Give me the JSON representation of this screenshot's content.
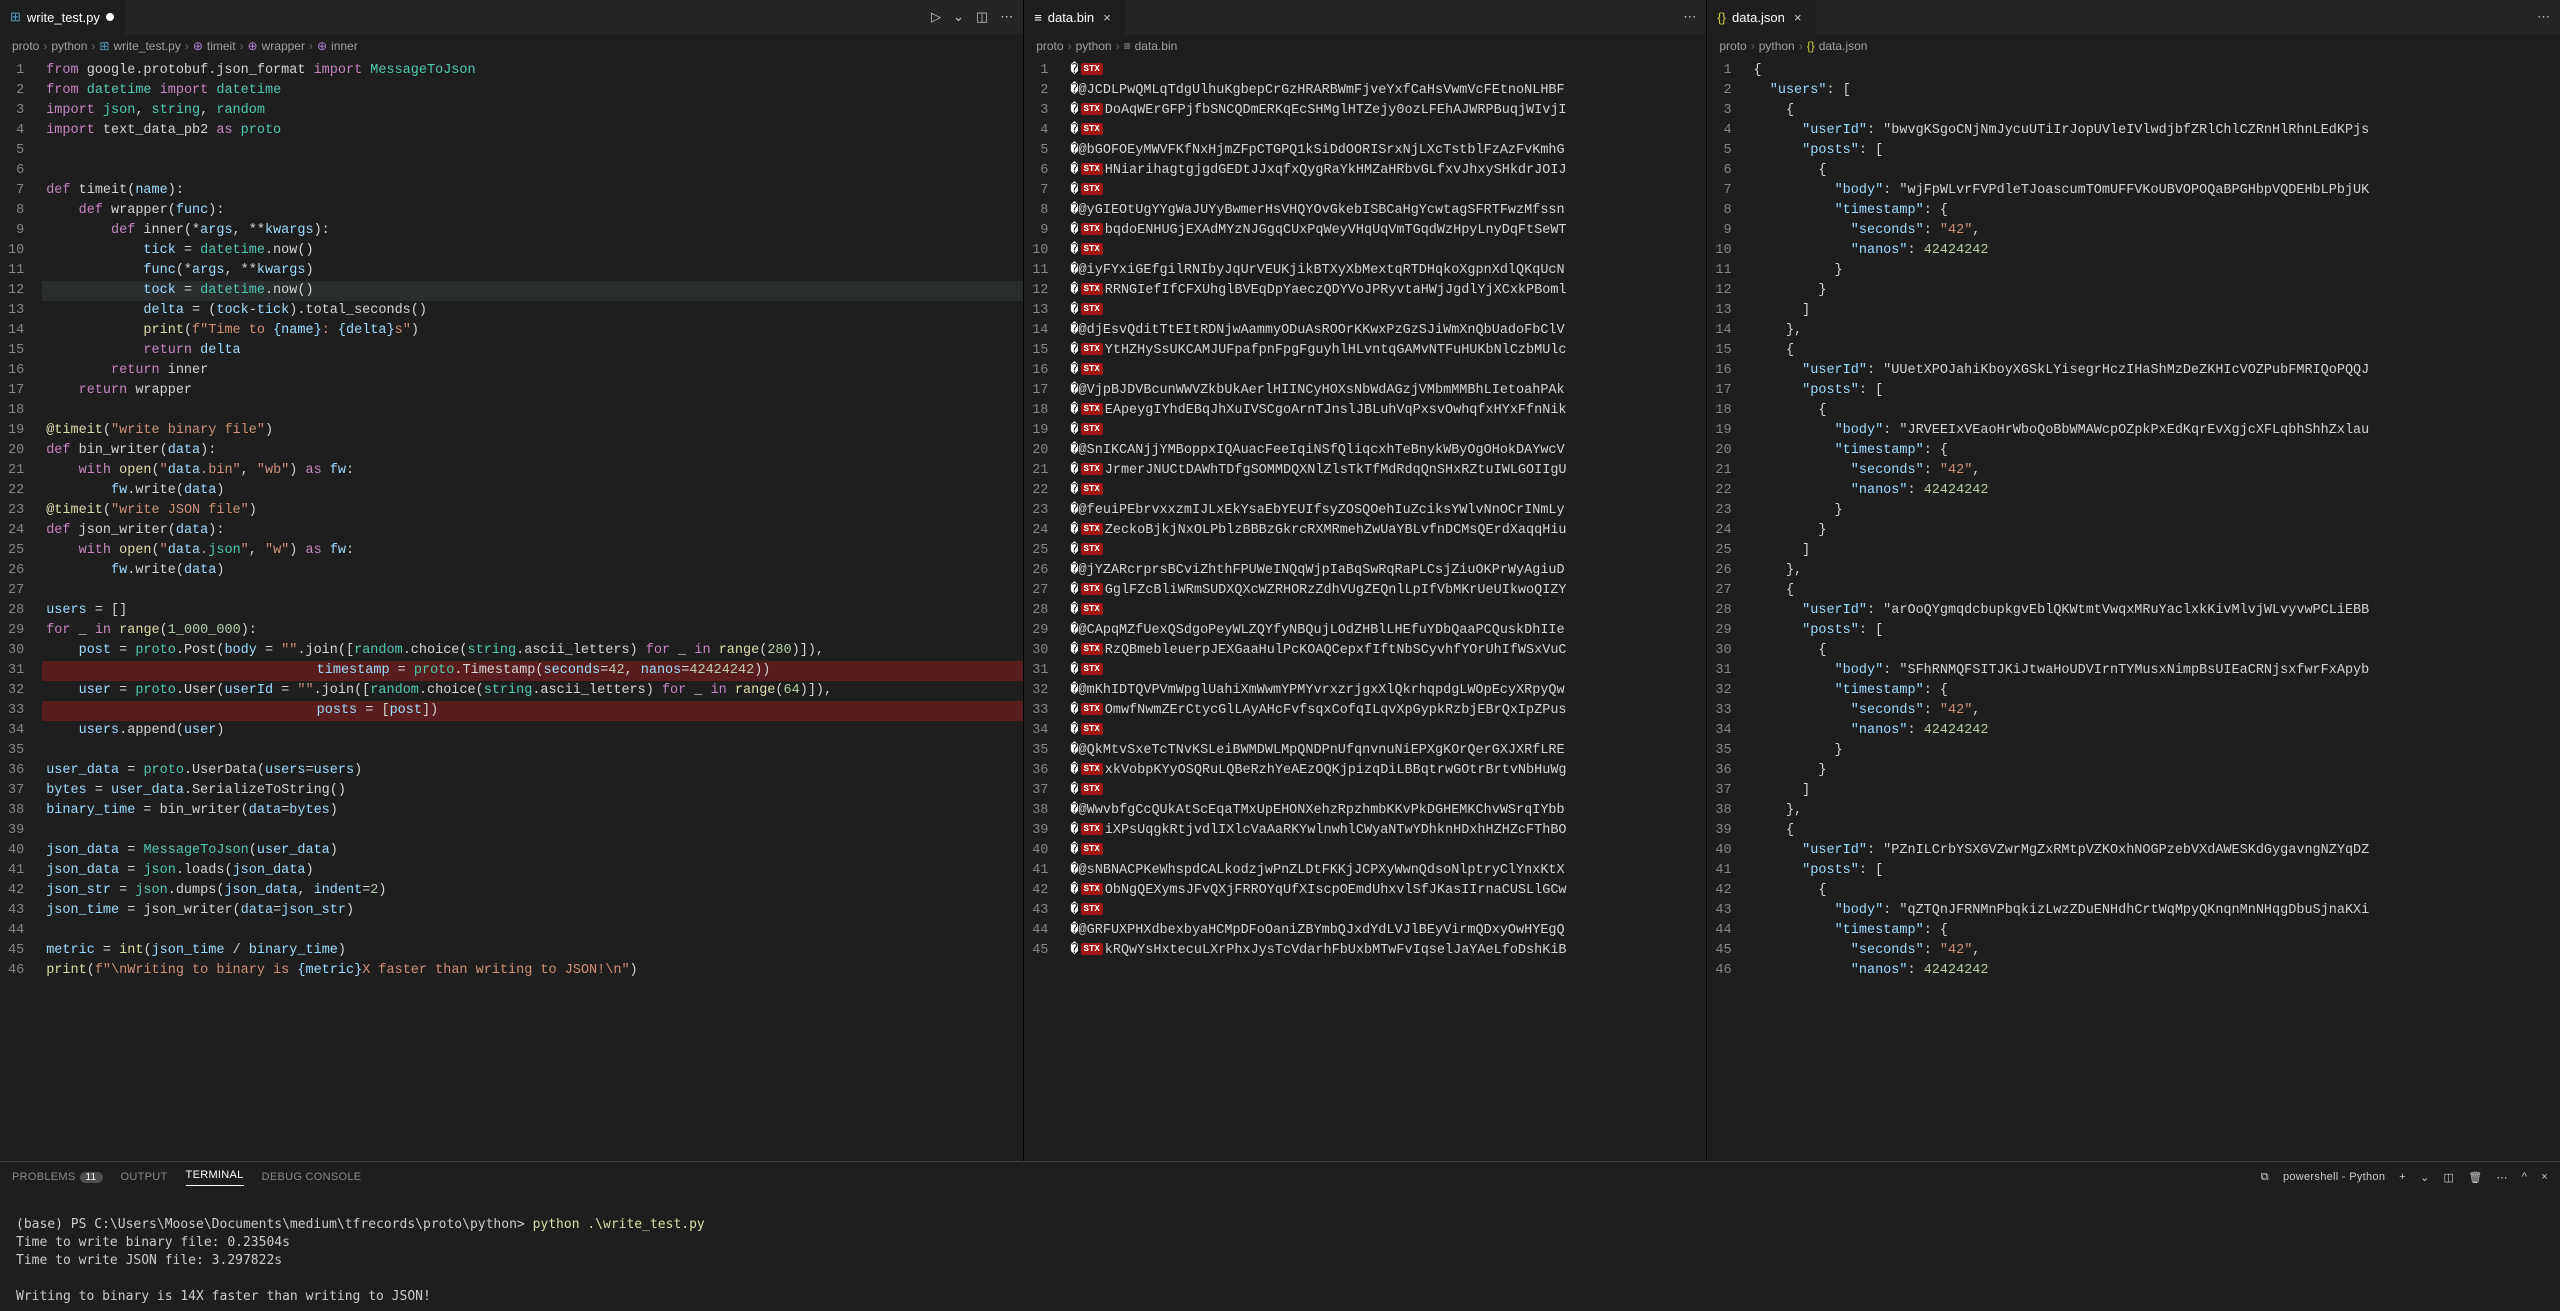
{
  "tabs": {
    "pane1": {
      "filename": "write_test.py",
      "modified": true
    },
    "pane2": {
      "filename": "data.bin",
      "modified": false
    },
    "pane3": {
      "filename": "data.json",
      "modified": false
    }
  },
  "breadcrumb": {
    "pane1": [
      "proto",
      "python",
      "write_test.py",
      "timeit",
      "wrapper",
      "inner"
    ],
    "pane2": [
      "proto",
      "python",
      "data.bin"
    ],
    "pane3": [
      "proto",
      "python",
      "data.json"
    ]
  },
  "code1": [
    "from google.protobuf.json_format import MessageToJson",
    "from datetime import datetime",
    "import json, string, random",
    "import text_data_pb2 as proto",
    "",
    "",
    "def timeit(name):",
    "    def wrapper(func):",
    "        def inner(*args, **kwargs):",
    "            tick = datetime.now()",
    "            func(*args, **kwargs)",
    "            tock = datetime.now()",
    "            delta = (tock-tick).total_seconds()",
    "            print(f\"Time to {name}: {delta}s\")",
    "            return delta",
    "        return inner",
    "    return wrapper",
    "",
    "@timeit(\"write binary file\")",
    "def bin_writer(data):",
    "    with open(\"data.bin\", \"wb\") as fw:",
    "        fw.write(data)",
    "@timeit(\"write JSON file\")",
    "def json_writer(data):",
    "    with open(\"data.json\", \"w\") as fw:",
    "        fw.write(data)",
    "",
    "users = []",
    "for _ in range(1_000_000):",
    "    post = proto.Post(body = \"\".join([random.choice(string.ascii_letters) for _ in range(280)]),",
    "                        timestamp = proto.Timestamp(seconds=42, nanos=42424242))",
    "    user = proto.User(userId = \"\".join([random.choice(string.ascii_letters) for _ in range(64)]),",
    "                        posts = [post])",
    "    users.append(user)",
    "",
    "user_data = proto.UserData(users=users)",
    "bytes = user_data.SerializeToString()",
    "binary_time = bin_writer(data=bytes)",
    "",
    "json_data = MessageToJson(user_data)",
    "json_data = json.loads(json_data)",
    "json_str = json.dumps(json_data, indent=2)",
    "json_time = json_writer(data=json_str)",
    "",
    "metric = int(json_time / binary_time)",
    "print(f\"\\nWriting to binary is {metric}X faster than writing to JSON!\\n\")"
  ],
  "code2": [
    "",
    "@JCDLPwQMLqTdgUlhuKgbepCrGzHRARBWmFjveYxfCaHsVwmVcFEtnoNLHBF",
    "DoAqWErGFPjfbSNCQDmERKqEcSHMglHTZejy0ozLFEhAJWRPBuqjWIvjI",
    "",
    "@bGOFOEyMWVFKfNxHjmZFpCTGPQ1kSiDdOORISrxNjLXcTstblFzAzFvKmhG",
    "HNiarihagtgjgdGEDtJJxqfxQygRaYkHMZaHRbvGLfxvJhxySHkdrJOIJ",
    "",
    "@yGIEOtUgYYgWaJUYyBwmerHsVHQYOvGkebISBCaHgYcwtagSFRTFwzMfssn",
    "bqdoENHUGjEXAdMYzNJGgqCUxPqWeyVHqUqVmTGqdWzHpyLnyDqFtSeWT",
    "",
    "@iyFYxiGEfgilRNIbyJqUrVEUKjikBTXyXbMextqRTDHqkoXgpnXdlQKqUcN",
    "RRNGIefIfCFXUhglBVEqDpYaeczQDYVoJPRyvtaHWjJgdlYjXCxkPBoml",
    "",
    "@djEsvQditTtEItRDNjwAammyODuAsROOrKKwxPzGzSJiWmXnQbUadoFbClV",
    "YtHZHySsUKCAMJUFpafpnFpgFguyhlHLvntqGAMvNTFuHUKbNlCzbMUlc",
    "",
    "@VjpBJDVBcunWWVZkbUkAerlHIINCyHOXsNbWdAGzjVMbmMMBhLIetoahPAk",
    "EApeygIYhdEBqJhXuIVSCgoArnTJnslJBLuhVqPxsvOwhqfxHYxFfnNik",
    "",
    "@SnIKCANjjYMBoppxIQAuacFeeIqiNSfQliqcxhTeBnykWByOgOHokDAYwcV",
    "JrmerJNUCtDAWhTDfgSOMMDQXNlZlsTkTfMdRdqQnSHxRZtuIWLGOIIgU",
    "",
    "@feuiPEbrvxxzmIJLxEkYsaEbYEUIfsyZOSQOehIuZciksYWlvNnOCrINmLy",
    "ZeckoBjkjNxOLPblzBBBzGkrcRXMRmehZwUaYBLvfnDCMsQErdXaqqHiu",
    "",
    "@jYZARcrprsBCviZhthFPUWeINQqWjpIaBqSwRqRaPLCsjZiuOKPrWyAgiuD",
    "GglFZcBliWRmSUDXQXcWZRHORzZdhVUgZEQnlLpIfVbMKrUeUIkwoQIZY",
    "",
    "@CApqMZfUexQSdgoPeyWLZQYfyNBQujLOdZHBlLHEfuYDbQaaPCQuskDhIIe",
    "RzQBmebleuerpJEXGaaHulPcKOAQCepxfIftNbSCyvhfYOrUhIfWSxVuC",
    "",
    "@mKhIDTQVPVmWpglUahiXmWwmYPMYvrxzrjgxXlQkrhqpdgLWOpEcyXRpyQw",
    "OmwfNwmZErCtycGlLAyAHcFvfsqxCofqILqvXpGypkRzbjEBrQxIpZPus",
    "",
    "@QkMtvSxeTcTNvKSLeiBWMDWLMpQNDPnUfqnvnuNiEPXgKOrQerGXJXRfLRE",
    "xkVobpKYyOSQRuLQBeRzhYeAEzOQKjpizqDiLBBqtrwGOtrBrtvNbHuWg",
    "",
    "@WwvbfgCcQUkAtScEqaTMxUpEHONXehzRpzhmbKKvPkDGHEMKChvWSrqIYbb",
    "iXPsUqgkRtjvdlIXlcVaAaRKYwlnwhlCWyaNTwYDhknHDxhHZHZcFThBO",
    "",
    "@sNBNACPKeWhspdCALkodzjwPnZLDtFKKjJCPXyWwnQdsoNlptryClYnxKtX",
    "ObNgQEXymsJFvQXjFRROYqUfXIscpOEmdUhxvlSfJKasIIrnaCUSLlGCw",
    "",
    "@GRFUXPHXdbexbyaHCMpDFoOaniZBYmbQJxdYdLVJlBEyVirmQDxyOwHYEgQ",
    "kRQwYsHxtecuLXrPhxJysTcVdarhFbUxbMTwFvIqselJaYAeLfoDshKiB"
  ],
  "code3": {
    "lines": [
      "{",
      "  \"users\": [",
      "    {",
      "      \"userId\": \"bwvgKSgoCNjNmJycuUTiIrJopUVleIVlwdjbfZRlChlCZRnHlRhnLEdKPjs",
      "      \"posts\": [",
      "        {",
      "          \"body\": \"wjFpWLvrFVPdleTJoascumTOmUFFVKoUBVOPOQaBPGHbpVQDEHbLPbjUK",
      "          \"timestamp\": {",
      "            \"seconds\": \"42\",",
      "            \"nanos\": 42424242",
      "          }",
      "        }",
      "      ]",
      "    },",
      "    {",
      "      \"userId\": \"UUetXPOJahiKboyXGSkLYisegrHczIHaShMzDeZKHIcVOZPubFMRIQoPQQJ",
      "      \"posts\": [",
      "        {",
      "          \"body\": \"JRVEEIxVEaoHrWboQoBbWMAWcpOZpkPxEdKqrEvXgjcXFLqbhShhZxlau",
      "          \"timestamp\": {",
      "            \"seconds\": \"42\",",
      "            \"nanos\": 42424242",
      "          }",
      "        }",
      "      ]",
      "    },",
      "    {",
      "      \"userId\": \"arOoQYgmqdcbupkgvEblQKWtmtVwqxMRuYaclxkKivMlvjWLvyvwPCLiEBB",
      "      \"posts\": [",
      "        {",
      "          \"body\": \"SFhRNMQFSITJKiJtwaHoUDVIrnTYMusxNimpBsUIEaCRNjsxfwrFxApyb",
      "          \"timestamp\": {",
      "            \"seconds\": \"42\",",
      "            \"nanos\": 42424242",
      "          }",
      "        }",
      "      ]",
      "    },",
      "    {",
      "      \"userId\": \"PZnILCrbYSXGVZwrMgZxRMtpVZKOxhNOGPzebVXdAWESKdGygavngNZYqDZ",
      "      \"posts\": [",
      "        {",
      "          \"body\": \"qZTQnJFRNMnPbqkizLwzZDuENHdhCrtWqMpyQKnqnMnNHqgDbuSjnaKXi",
      "          \"timestamp\": {",
      "            \"seconds\": \"42\",",
      "            \"nanos\": 42424242"
    ]
  },
  "terminal": {
    "tabs": {
      "problems": "PROBLEMS",
      "problems_badge": "11",
      "output": "OUTPUT",
      "terminal": "TERMINAL",
      "debug": "DEBUG CONSOLE"
    },
    "shell_label": "powershell - Python",
    "prompt": "(base) PS C:\\Users\\Moose\\Documents\\medium\\tfrecords\\proto\\python>",
    "command": "python .\\write_test.py",
    "out1": "Time to write binary file: 0.23504s",
    "out2": "Time to write JSON file: 3.297822s",
    "out3": "",
    "out4": "Writing to binary is 14X faster than writing to JSON!"
  },
  "icons": {
    "run": "▷",
    "split": "▫",
    "more": "⋯",
    "close": "×",
    "plus": "+",
    "trash": "🗑",
    "maximize": "^"
  }
}
